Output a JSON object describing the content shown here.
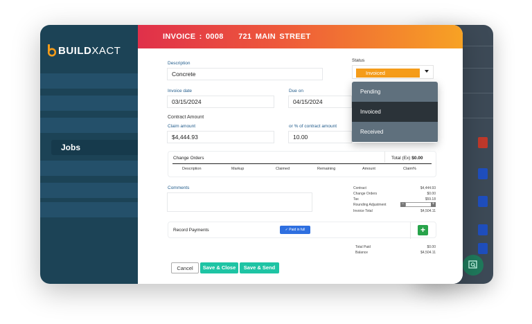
{
  "header": {
    "title": "INVOICE : 0008    721 MAIN STREET"
  },
  "brand": {
    "name_bold": "BUILD",
    "name_rest": "XACT",
    "accent": "#f59c1a"
  },
  "sidebar": {
    "active_item": "Jobs"
  },
  "form": {
    "description_label": "Description",
    "description_value": "Concrete",
    "status_label": "Status",
    "status_value": "Invoiced",
    "invoice_date_label": "Invoice date",
    "invoice_date_value": "03/15/2024",
    "due_on_label": "Due on",
    "due_on_value": "04/15/2024",
    "contract_amount_label": "Contract Amount",
    "claim_amount_label": "Claim amount",
    "claim_amount_value": "$4,444.93",
    "percent_label": "or % of contract amount",
    "percent_value": "10.00"
  },
  "status_dropdown": {
    "options": [
      "Pending",
      "Invoiced",
      "Received"
    ],
    "selected": "Invoiced"
  },
  "change_orders": {
    "title": "Change Orders",
    "total_label": "Total (Ex)",
    "total_value": "$0.00",
    "columns": [
      "Description",
      "Markup",
      "Claimed",
      "Remaining",
      "Amount",
      "Claim%"
    ]
  },
  "comments": {
    "label": "Comments"
  },
  "summary": {
    "rows": [
      {
        "label": "Contract",
        "value": "$4,444.93"
      },
      {
        "label": "Change Orders",
        "value": "$0.00"
      },
      {
        "label": "Tax",
        "value": "$59.18"
      },
      {
        "label": "Rounding Adjustment",
        "value": ""
      },
      {
        "label": "Invoice Total",
        "value": "$4,504.11"
      }
    ],
    "total_paid_label": "Total Paid",
    "total_paid_value": "$0.00",
    "balance_label": "Balance",
    "balance_value": "$4,504.11"
  },
  "payments": {
    "title": "Record Payments",
    "paid_in_full_label": "✓ Paid in full",
    "add_label": "+"
  },
  "actions": {
    "cancel": "Cancel",
    "save_close": "Save & Close",
    "save_send": "Save & Send"
  }
}
